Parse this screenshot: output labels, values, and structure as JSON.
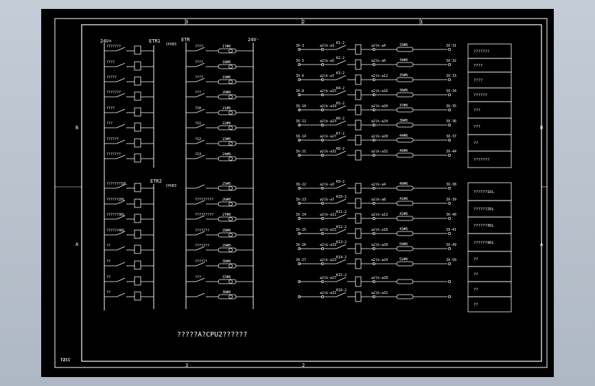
{
  "frame": {
    "top_zones": [
      "3",
      "2",
      "1"
    ],
    "bottom_zones": [
      "3",
      "2"
    ],
    "side_zones": [
      "B",
      "A"
    ],
    "title_block_text": "TZCC"
  },
  "left": {
    "bus_pos": "24V+",
    "bus_neg": "24V-",
    "etr1": "ETR1",
    "etr": "ETR",
    "etr2": "ETR2",
    "cpu_tag1": "CPU03",
    "cpu_tag2": "CPU03",
    "rows": [
      {
        "in": "???????",
        "out": "????",
        "code": "17#8"
      },
      {
        "in": "????",
        "out": "????",
        "code": "18#8"
      },
      {
        "in": "?????",
        "out": "????",
        "code": "19#8"
      },
      {
        "in": "???????",
        "out": "???",
        "code": "20#8"
      },
      {
        "in": "????",
        "out": "?10",
        "code": "21#8"
      },
      {
        "in": "???",
        "out": "?11",
        "code": "22#8"
      },
      {
        "in": "??????",
        "out": "?12",
        "code": "23#8"
      },
      {
        "in": "???????",
        "out": "?13",
        "code": "24#8"
      },
      {
        "in": "???????1DL",
        "out": "",
        "code": "25#8"
      },
      {
        "in": "??????2DL",
        "out": "?????????",
        "code": "26#8"
      },
      {
        "in": "??????3DL",
        "out": "?????????",
        "code": "27#8"
      },
      {
        "in": "??????4DL",
        "out": "???????",
        "code": "28#8"
      },
      {
        "in": "??",
        "out": "???????",
        "code": "29#8"
      },
      {
        "in": "??",
        "out": "??????",
        "code": "30#8"
      },
      {
        "in": "??",
        "out": "???",
        "code": "37#8"
      },
      {
        "in": "??",
        "out": "",
        "code": "38#8"
      }
    ]
  },
  "right": {
    "rows": [
      {
        "term": "3X-3",
        "d1": "a2(k-a3",
        "k": "K1-2",
        "d2": "a2(k-a4",
        "code": "33#8",
        "end": "3X-31"
      },
      {
        "term": "3X-5",
        "d1": "a2(k-a5",
        "k": "K2-2",
        "d2": "a2(k-a6",
        "code": "34#8",
        "end": "3X-32"
      },
      {
        "term": "3X-6",
        "d1": "a2(k-a7",
        "k": "K3-2",
        "d2": "a2(k-a12",
        "code": "35#8",
        "end": "3X-33"
      },
      {
        "term": "3X-8",
        "d1": "a2(k-a15",
        "k": "K4-2",
        "d2": "a2(k-a16",
        "code": "36#8",
        "end": "3X-34"
      },
      {
        "term": "3X-10",
        "d1": "a2(k-a19",
        "k": "K5-2",
        "d2": "a2(k-a20",
        "code": "37#8",
        "end": "3X-35"
      },
      {
        "term": "3X-12",
        "d1": "a2(k-a23",
        "k": "K6-2",
        "d2": "a2(k-a24",
        "code": "38#8",
        "end": "3X-36"
      },
      {
        "term": "3X-14",
        "d1": "a2(k-a27",
        "k": "K7-2",
        "d2": "a2(k-a28",
        "code": "44#8",
        "end": "3X-37"
      },
      {
        "term": "3X-21",
        "d1": "a2(k-a31",
        "k": "K8-2",
        "d2": "a2(k-a32",
        "code": "46#8",
        "end": "3X-44"
      },
      {
        "term": "3X-22",
        "d1": "a2(k-a3",
        "k": "K9-2",
        "d2": "a2(k-a4",
        "code": "40#8",
        "end": "3X-38"
      },
      {
        "term": "3X-23",
        "d1": "a2(k-a7",
        "k": "K10-2",
        "d2": "a2(k-a8",
        "code": "41#8",
        "end": "3X-39"
      },
      {
        "term": "3X-24",
        "d1": "a2(k-a11",
        "k": "K11-2",
        "d2": "a2(k-a12",
        "code": "42#8",
        "end": "3X-40"
      },
      {
        "term": "3X-25",
        "d1": "a2(k-a15",
        "k": "K12-2",
        "d2": "a2(k-a16",
        "code": "43#8",
        "end": "3X-41"
      },
      {
        "term": "3X-26",
        "d1": "a2(k-a19",
        "k": "K13-2",
        "d2": "a2(k-a20",
        "code": "50#8",
        "end": "3X-49"
      },
      {
        "term": "3X-27",
        "d1": "a2(k-a23",
        "k": "K14-2",
        "d2": "a2(k-a24",
        "code": "52#8",
        "end": "3X-50"
      },
      {
        "term": "",
        "d1": "a2(k-a27",
        "k": "K15-2",
        "d2": "a2(k-a28",
        "code": "",
        "end": ""
      },
      {
        "term": "",
        "d1": "a2(k-a31",
        "k": "K16-2",
        "d2": "a2(k-a32",
        "code": "",
        "end": ""
      }
    ]
  },
  "legend": [
    "???????",
    "????",
    "????",
    "??????",
    "???",
    "???",
    "??",
    "???????",
    "??????1DL",
    "??????2DL",
    "??????3DL",
    "??????4DL",
    "??",
    "??",
    "??",
    "??"
  ],
  "caption": "?????A?CPU2??????"
}
